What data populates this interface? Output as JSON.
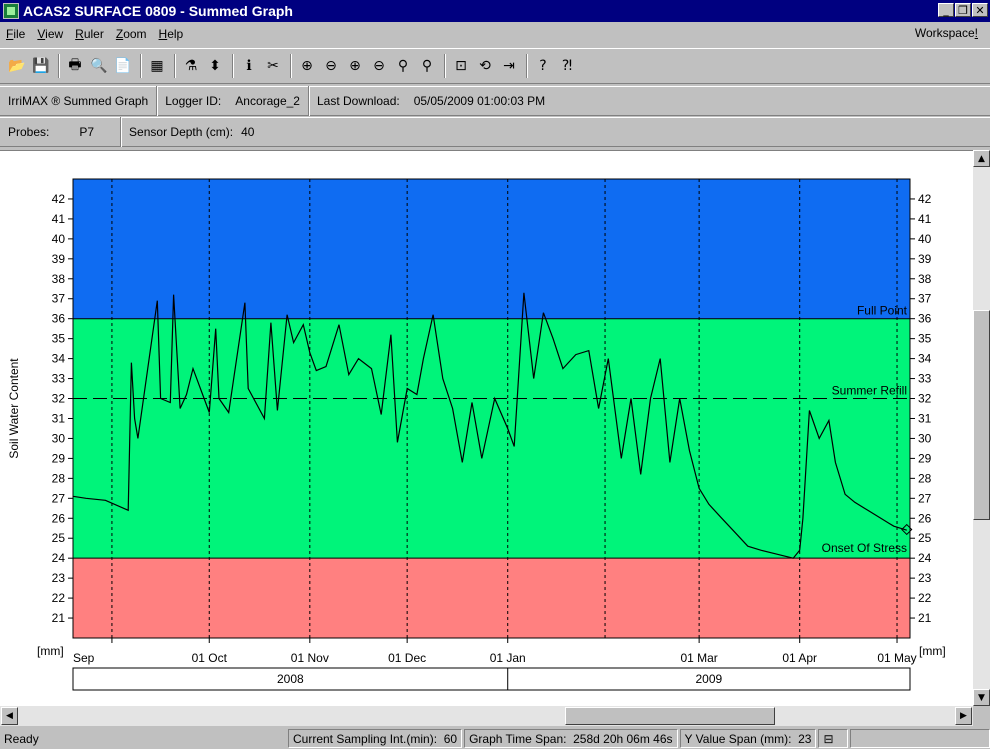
{
  "window": {
    "title": "ACAS2 SURFACE 0809 - Summed Graph"
  },
  "menu": {
    "items": [
      {
        "name": "menu-file",
        "ul": "F",
        "rest": "ile"
      },
      {
        "name": "menu-view",
        "ul": "V",
        "rest": "iew"
      },
      {
        "name": "menu-ruler",
        "ul": "R",
        "rest": "uler"
      },
      {
        "name": "menu-zoom",
        "ul": "Z",
        "rest": "oom"
      },
      {
        "name": "menu-help",
        "ul": "H",
        "rest": "elp"
      }
    ],
    "workspace_pre": "Workspace",
    "workspace_ul": "!"
  },
  "toolbar": {
    "icons": [
      "open-icon",
      "save-icon",
      "|",
      "print-icon",
      "print-preview-icon",
      "document-icon",
      "|",
      "calculator-icon",
      "|",
      "sensor-icon",
      "sensor-detail-icon",
      "|",
      "probe-info-icon",
      "probe-disabled-icon",
      "|",
      "zoom-in-x-icon",
      "zoom-out-x-icon",
      "zoom-in-y-icon",
      "zoom-out-y-icon",
      "zoom-baseline-icon",
      "zoom-range-icon",
      "|",
      "zoom-window-icon",
      "zoom-reset-icon",
      "goto-end-icon",
      "|",
      "help-icon",
      "context-help-icon"
    ]
  },
  "info1": {
    "product": "IrriMAX ® Summed Graph",
    "logger_label": "Logger ID:",
    "logger_value": "Ancorage_2",
    "download_label": "Last Download:",
    "download_value": "05/05/2009 01:00:03 PM"
  },
  "info2": {
    "probes_label": "Probes:",
    "probes_value": "P7",
    "depth_label": "Sensor Depth (cm):",
    "depth_value": "40"
  },
  "status": {
    "ready": "Ready",
    "sampling": "Current Sampling Int.(min):  60",
    "timespan": "Graph Time Span:  258d 20h 06m 46s",
    "yspan": "Y Value Span (mm):  23"
  },
  "chart_data": {
    "type": "line",
    "ylabel": "Soil Water Content",
    "unit_label": "[mm]",
    "ylim": [
      20,
      43
    ],
    "yticks": [
      21,
      22,
      23,
      24,
      25,
      26,
      27,
      28,
      29,
      30,
      31,
      32,
      33,
      34,
      35,
      36,
      37,
      38,
      39,
      40,
      41,
      42
    ],
    "xlim": [
      "2008-08-20",
      "2009-05-05"
    ],
    "x_tick_labels": [
      "Sep",
      "01 Oct",
      "01 Nov",
      "01 Dec",
      "01 Jan",
      "01 Mar",
      "01 Apr",
      "01 May"
    ],
    "x_tick_dates": [
      "2008-09-01",
      "2008-10-01",
      "2008-11-01",
      "2008-12-01",
      "2009-01-01",
      "2009-03-01",
      "2009-04-01",
      "2009-05-01"
    ],
    "extra_gridlines": [
      "2009-01-31"
    ],
    "years": [
      {
        "label": "2008"
      },
      {
        "label": "2009"
      }
    ],
    "bands": [
      {
        "from": 36,
        "to": 43,
        "color": "#0f6cf2"
      },
      {
        "from": 24,
        "to": 36,
        "color": "#00f47a"
      },
      {
        "from": 20,
        "to": 24,
        "color": "#ff8080"
      }
    ],
    "reference_lines": [
      {
        "label": "Full Point",
        "value": 36,
        "style": "solid"
      },
      {
        "label": "Summer Refill",
        "value": 32,
        "style": "dashed"
      },
      {
        "label": "Onset Of Stress",
        "value": 24,
        "style": "solid"
      }
    ],
    "series": [
      {
        "x": [
          "2008-08-20",
          "2008-08-24",
          "2008-08-30",
          "2008-09-06",
          "2008-09-07",
          "2008-09-08",
          "2008-09-09",
          "2008-09-15",
          "2008-09-16",
          "2008-09-19",
          "2008-09-20",
          "2008-09-22",
          "2008-09-24",
          "2008-09-26",
          "2008-10-01",
          "2008-10-03",
          "2008-10-04",
          "2008-10-07",
          "2008-10-12",
          "2008-10-13",
          "2008-10-18",
          "2008-10-20",
          "2008-10-22",
          "2008-10-25",
          "2008-10-27",
          "2008-10-30",
          "2008-11-01",
          "2008-11-03",
          "2008-11-06",
          "2008-11-10",
          "2008-11-13",
          "2008-11-16",
          "2008-11-20",
          "2008-11-23",
          "2008-11-26",
          "2008-11-28",
          "2008-12-01",
          "2008-12-04",
          "2008-12-06",
          "2008-12-09",
          "2008-12-12",
          "2008-12-15",
          "2008-12-18",
          "2008-12-21",
          "2008-12-24",
          "2008-12-28",
          "2009-01-01",
          "2009-01-03",
          "2009-01-06",
          "2009-01-09",
          "2009-01-12",
          "2009-01-15",
          "2009-01-18",
          "2009-01-22",
          "2009-01-26",
          "2009-01-29",
          "2009-02-01",
          "2009-02-05",
          "2009-02-08",
          "2009-02-11",
          "2009-02-14",
          "2009-02-17",
          "2009-02-20",
          "2009-02-23",
          "2009-02-26",
          "2009-03-01",
          "2009-03-04",
          "2009-03-08",
          "2009-03-12",
          "2009-03-16",
          "2009-03-20",
          "2009-03-25",
          "2009-03-30",
          "2009-04-01",
          "2009-04-02",
          "2009-04-04",
          "2009-04-07",
          "2009-04-10",
          "2009-04-12",
          "2009-04-15",
          "2009-04-18",
          "2009-04-22",
          "2009-04-26",
          "2009-04-30",
          "2009-05-04"
        ],
        "y": [
          27.1,
          27.0,
          26.9,
          26.4,
          33.8,
          31.0,
          30.0,
          36.9,
          32.0,
          31.8,
          37.2,
          31.5,
          32.2,
          33.5,
          31.3,
          35.5,
          32.0,
          31.3,
          36.8,
          32.5,
          31.0,
          35.8,
          31.4,
          36.2,
          34.8,
          35.7,
          34.3,
          33.4,
          33.6,
          35.7,
          33.2,
          34.0,
          33.5,
          31.2,
          35.2,
          29.8,
          32.5,
          32.2,
          34.0,
          36.2,
          33.0,
          31.5,
          28.8,
          31.8,
          29.0,
          32.0,
          30.5,
          29.6,
          37.3,
          33.0,
          36.3,
          35.0,
          33.5,
          34.2,
          34.4,
          31.5,
          34.0,
          29.0,
          32.0,
          28.2,
          32.0,
          34.0,
          28.8,
          32.0,
          29.4,
          27.5,
          26.7,
          26.0,
          25.3,
          24.6,
          24.4,
          24.2,
          24.0,
          24.4,
          26.0,
          31.4,
          30.0,
          30.9,
          28.8,
          27.2,
          26.8,
          26.4,
          26.0,
          25.6,
          25.4
        ]
      }
    ]
  }
}
